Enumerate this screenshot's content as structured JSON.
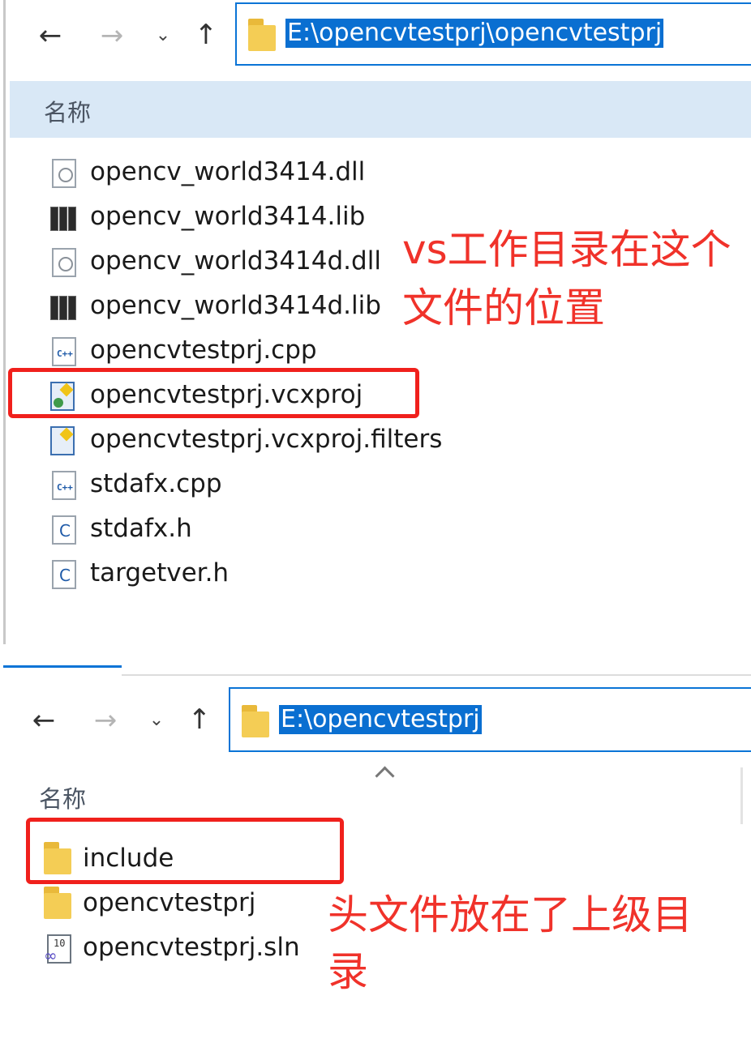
{
  "top_window": {
    "path": "E:\\opencvtestprj\\opencvtestprj",
    "column_header": "名称",
    "files": [
      {
        "name": "opencv_world3414.dll",
        "icon": "dll-icon"
      },
      {
        "name": "opencv_world3414.lib",
        "icon": "lib-icon"
      },
      {
        "name": "opencv_world3414d.dll",
        "icon": "dll-icon"
      },
      {
        "name": "opencv_world3414d.lib",
        "icon": "lib-icon"
      },
      {
        "name": "opencvtestprj.cpp",
        "icon": "cpp-file-icon"
      },
      {
        "name": "opencvtestprj.vcxproj",
        "icon": "vcxproj-icon"
      },
      {
        "name": "opencvtestprj.vcxproj.filters",
        "icon": "vcxproj-filters-icon"
      },
      {
        "name": "stdafx.cpp",
        "icon": "cpp-file-icon"
      },
      {
        "name": "stdafx.h",
        "icon": "header-file-icon"
      },
      {
        "name": "targetver.h",
        "icon": "header-file-icon"
      }
    ],
    "annotation_line1": "vs工作目录在这个",
    "annotation_line2": "文件的位置"
  },
  "bottom_window": {
    "path": "E:\\opencvtestprj",
    "column_header": "名称",
    "items": [
      {
        "name": "include",
        "icon": "folder-icon"
      },
      {
        "name": "opencvtestprj",
        "icon": "folder-icon"
      },
      {
        "name": "opencvtestprj.sln",
        "icon": "sln-icon"
      }
    ],
    "annotation_line1": "头文件放在了上级目",
    "annotation_line2": "录"
  },
  "colors": {
    "selection": "#0a6fd1",
    "address_border": "#0a74d6",
    "header_bg": "#d9e8f6",
    "highlight_red": "#f0201c",
    "folder": "#f4cd55"
  }
}
